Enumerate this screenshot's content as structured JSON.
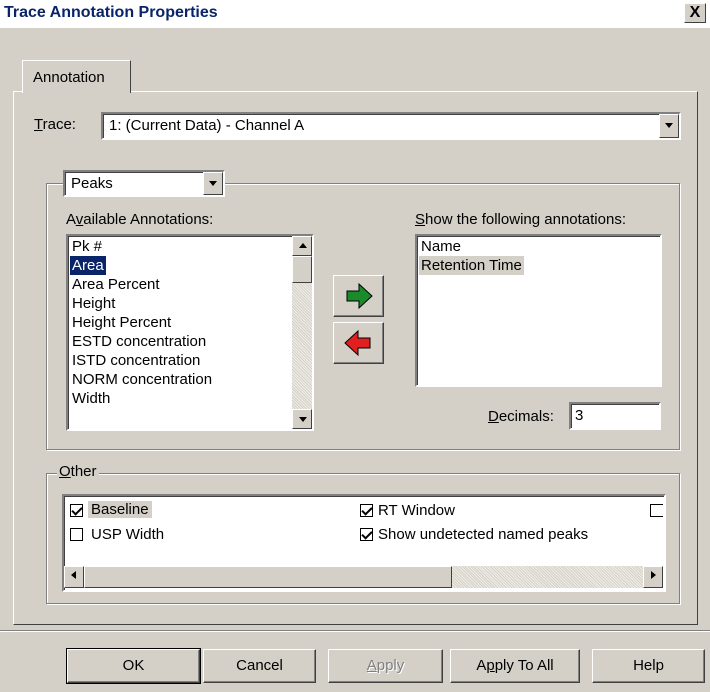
{
  "window": {
    "title": "Trace Annotation Properties",
    "close_label": "X"
  },
  "tab": {
    "label": "Annotation"
  },
  "trace": {
    "label_mnemonic": "T",
    "label_rest": "race:",
    "value": "1: (Current Data) - Channel A"
  },
  "group": {
    "type_value": "Peaks"
  },
  "available": {
    "label_pre": "A",
    "label_mnemonic": "v",
    "label_rest": "ailable Annotations:",
    "items": [
      "Pk #",
      "Area",
      "Area Percent",
      "Height",
      "Height Percent",
      "ESTD concentration",
      "ISTD concentration",
      "NORM concentration",
      "Width"
    ],
    "selected_index": 1
  },
  "show": {
    "label_mnemonic": "S",
    "label_rest": "how the following annotations:",
    "items": [
      "Name",
      "Retention Time"
    ],
    "selected_index": 1
  },
  "decimals": {
    "label_mnemonic": "D",
    "label_rest": "ecimals:",
    "value": "3"
  },
  "other": {
    "label_mnemonic": "O",
    "label_rest": "ther",
    "checkboxes": [
      {
        "label": "Baseline",
        "checked": true
      },
      {
        "label": "RT Window",
        "checked": true
      },
      {
        "label": "USP Width",
        "checked": false
      },
      {
        "label": "Show undetected named peaks",
        "checked": true
      }
    ]
  },
  "buttons": {
    "ok": "OK",
    "cancel": "Cancel",
    "apply_mnemonic": "A",
    "apply_rest": "pply",
    "apply_all_pre": "A",
    "apply_all_mnemonic": "p",
    "apply_all_rest": "ply To All",
    "help": "Help"
  },
  "icons": {
    "add_arrow": "green-right-arrow",
    "remove_arrow": "red-left-arrow",
    "add_color": "#1a8a2a",
    "remove_color": "#e02020"
  }
}
